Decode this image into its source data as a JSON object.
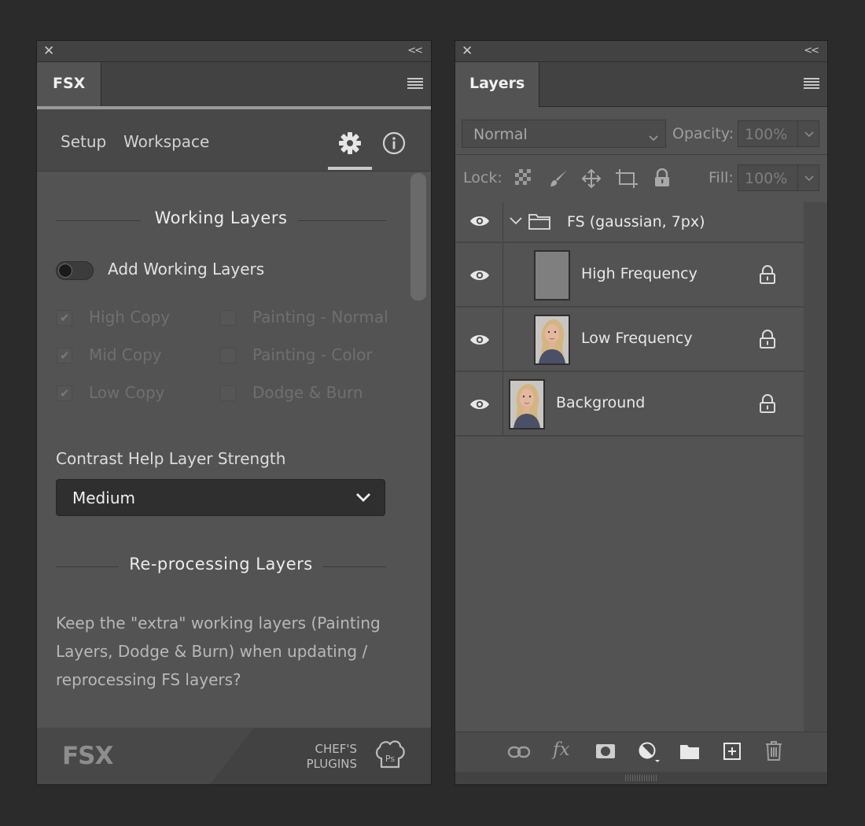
{
  "fsx_panel": {
    "close_glyph": "✕",
    "collapse_glyph": "<<",
    "tab_label": "FSX",
    "nav": {
      "setup": "Setup",
      "workspace": "Workspace"
    },
    "icons": {
      "settings": "gear-icon",
      "info": "info-icon"
    },
    "working_layers": {
      "title": "Working Layers",
      "toggle_label": "Add Working Layers",
      "toggle_on": false,
      "checkboxes": [
        {
          "label": "High Copy",
          "checked": true
        },
        {
          "label": "Painting - Normal",
          "checked": false
        },
        {
          "label": "Mid Copy",
          "checked": true
        },
        {
          "label": "Painting - Color",
          "checked": false
        },
        {
          "label": "Low Copy",
          "checked": true
        },
        {
          "label": "Dodge & Burn",
          "checked": false
        }
      ]
    },
    "contrast": {
      "label": "Contrast Help Layer Strength",
      "value": "Medium"
    },
    "reprocessing": {
      "title": "Re-processing Layers",
      "text": "Keep the \"extra\" working layers (Painting Layers, Dodge & Burn) when updating / reprocessing FS layers?"
    },
    "footer": {
      "logo": "FSX",
      "brand_line1": "CHEF'S",
      "brand_line2": "PLUGINS",
      "brand_badge": "Ps"
    }
  },
  "layers_panel": {
    "close_glyph": "✕",
    "collapse_glyph": "<<",
    "tab_label": "Layers",
    "blend_mode": "Normal",
    "opacity_label": "Opacity:",
    "opacity_value": "100%",
    "lock_label": "Lock:",
    "fill_label": "Fill:",
    "fill_value": "100%",
    "layers": [
      {
        "name": "FS (gaussian, 7px)",
        "kind": "group",
        "visible": true,
        "locked": false
      },
      {
        "name": "High Frequency",
        "kind": "gray",
        "visible": true,
        "locked": true
      },
      {
        "name": "Low Frequency",
        "kind": "portrait",
        "visible": true,
        "locked": true
      },
      {
        "name": "Background",
        "kind": "portrait",
        "visible": true,
        "locked": true
      }
    ],
    "footer_icons": [
      "link-icon",
      "fx-icon",
      "mask-icon",
      "adjustment-icon",
      "folder-icon",
      "new-layer-icon",
      "trash-icon"
    ],
    "footer_fx": "fx"
  },
  "colors": {
    "app_bg": "#2b2b2b",
    "panel_bg": "#535353",
    "header_bg": "#424242",
    "accent_text": "#f0f0f0"
  }
}
